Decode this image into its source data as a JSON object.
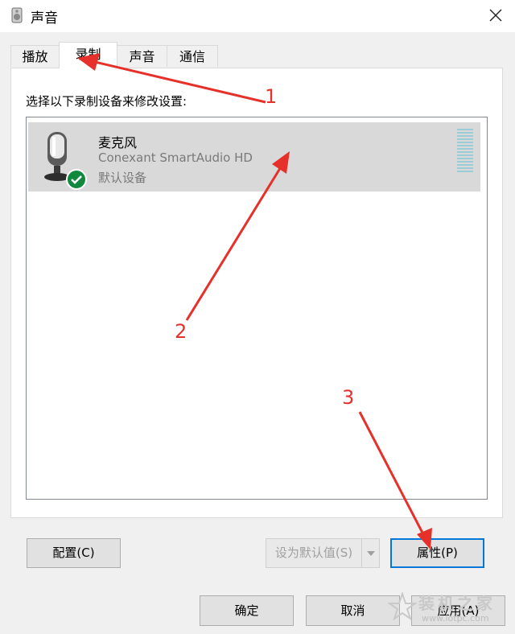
{
  "window": {
    "title": "声音"
  },
  "tabs": [
    {
      "label": "播放"
    },
    {
      "label": "录制"
    },
    {
      "label": "声音"
    },
    {
      "label": "通信"
    }
  ],
  "recording": {
    "instruction": "选择以下录制设备来修改设置:",
    "device": {
      "name": "麦克风",
      "description": "Conexant SmartAudio HD",
      "status": "默认设备",
      "status_icon": "green-check-icon",
      "level_meter_icon": "level-meter-icon"
    }
  },
  "panel_buttons": {
    "configure": "配置(C)",
    "set_default": "设为默认值(S)",
    "properties": "属性(P)"
  },
  "dialog_buttons": {
    "ok": "确定",
    "cancel": "取消",
    "apply": "应用(A)"
  },
  "annotations": [
    "1",
    "2",
    "3"
  ],
  "watermark": {
    "text": "装机之家",
    "url": "www.lotpc.com"
  },
  "colors": {
    "accent": "#0078d7",
    "annotation_red": "#e6302a",
    "check_green": "#10893e"
  }
}
